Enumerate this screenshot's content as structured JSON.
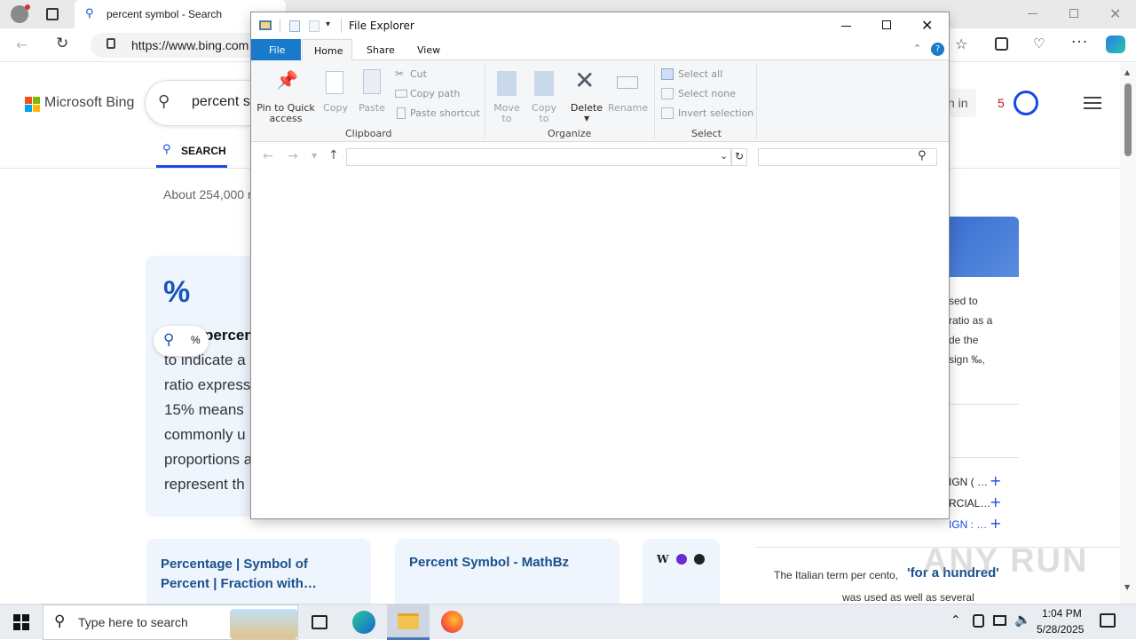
{
  "browser": {
    "tab_title": "percent symbol - Search",
    "address": "https://www.bing.com",
    "address_main": "https://www.bing.com"
  },
  "bing": {
    "logo_text": "Microsoft Bing",
    "search_query": "percent sy",
    "sign_in": "n in",
    "rewards_count": "5",
    "tab_search": "SEARCH",
    "results_count": "About 254,000 r",
    "answer_symbol": "%",
    "answer_heading": "percent",
    "answer_lines": [
      "to indicate a",
      "ratio express",
      "15% means",
      "commonly u",
      "proportions a",
      "represent th"
    ],
    "chip_label": "%",
    "cards": [
      {
        "title": "Percentage | Symbol of Percent | Fraction with…"
      },
      {
        "title": "Percent Symbol - MathBz"
      }
    ],
    "side_text": [
      "sed to",
      "ratio as a",
      "de the",
      "sign ‰,"
    ],
    "side_list": [
      "IGN ( …",
      "RCIAL…",
      "IGN : …"
    ],
    "bottom_text_1": "The Italian term per cento,",
    "bottom_text_bold": "'for a hundred'",
    "bottom_text_2": "was used as well as several"
  },
  "explorer": {
    "title": "File Explorer",
    "tabs": {
      "file": "File",
      "home": "Home",
      "share": "Share",
      "view": "View"
    },
    "clipboard": {
      "pin": "Pin to Quick access",
      "copy": "Copy",
      "paste": "Paste",
      "cut": "Cut",
      "copy_path": "Copy path",
      "paste_shortcut": "Paste shortcut",
      "group": "Clipboard"
    },
    "organize": {
      "move_to": "Move to",
      "copy_to": "Copy to",
      "delete": "Delete",
      "rename": "Rename",
      "group": "Organize"
    },
    "select": {
      "select_all": "Select all",
      "select_none": "Select none",
      "invert": "Invert selection",
      "group": "Select"
    },
    "address_value": "",
    "search_placeholder": ""
  },
  "taskbar": {
    "search_placeholder": "Type here to search",
    "time": "1:04 PM",
    "date": "5/28/2025"
  },
  "watermark": "ANY RUN",
  "colors": {
    "bing_blue": "#0a5ad4",
    "explorer_file_tab": "#1979ca",
    "accent_card": "#eef5fd"
  }
}
